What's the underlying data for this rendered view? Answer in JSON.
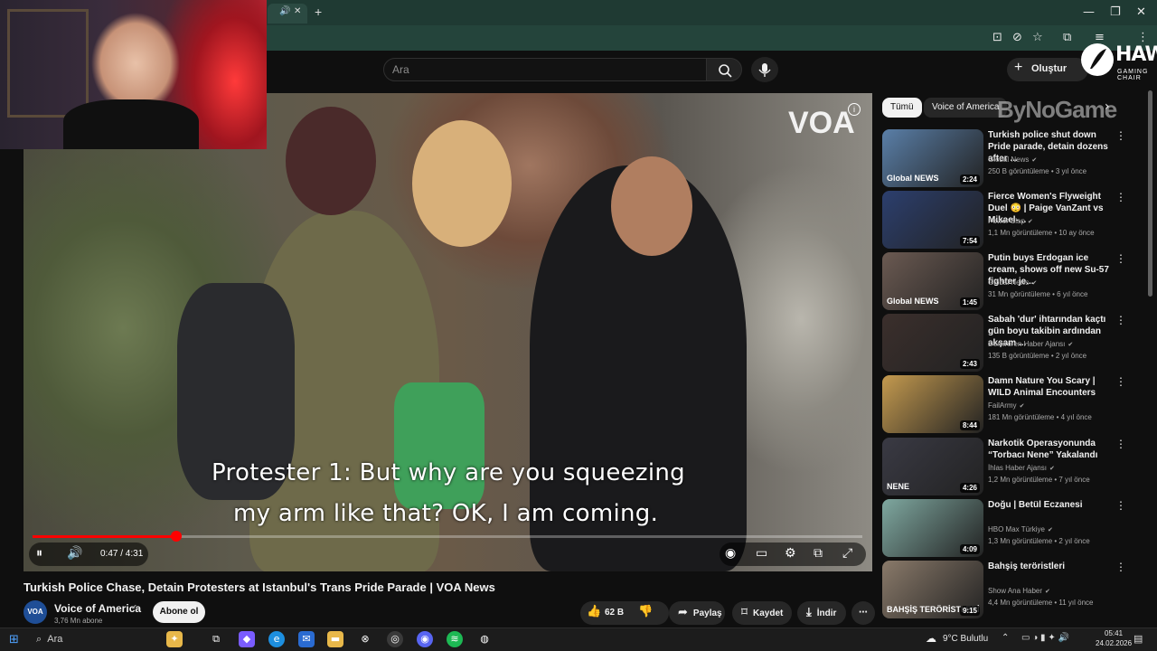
{
  "browser": {
    "tab_close": "✕",
    "new_tab": "+",
    "window_controls": [
      "—",
      "❐",
      "✕"
    ],
    "toolbar_icons": [
      "install-icon",
      "eye-off-icon",
      "star-icon",
      "extensions-icon",
      "profile-icon",
      "menu-icon"
    ]
  },
  "header": {
    "search_placeholder": "Ara",
    "create_label": "Oluştur"
  },
  "player": {
    "subtitle_line1": "Protester 1: But why are you squeezing",
    "subtitle_line2": "my arm like that? OK, I am coming.",
    "watermark": "VOA",
    "current_time": "0:47",
    "duration": "4:31",
    "time_display": "0:47 / 4:31",
    "progress_fraction": 0.173
  },
  "video": {
    "title": "Turkish Police Chase, Detain Protesters at Istanbul's Trans Pride Parade | VOA News",
    "channel_avatar": "VOA",
    "channel_name": "Voice of America",
    "subscribers": "3,76 Mn abone",
    "subscribe_label": "Abone ol",
    "like_count": "62 B",
    "share_label": "Paylaş",
    "save_label": "Kaydet",
    "download_label": "İndir"
  },
  "sidebar": {
    "chips": [
      "Tümü",
      "Voice of America"
    ],
    "recommendations": [
      {
        "title": "Turkish police shut down Pride parade, detain dozens after ...",
        "channel": "Global News",
        "meta": "250 B görüntüleme • 3 yıl önce",
        "duration": "2:24",
        "thumb_color": "#5a7fa8",
        "thumb_tag": "Global NEWS"
      },
      {
        "title": "Fierce Women's Flyweight Duel 😳 | Paige VanZant vs Mikael-...",
        "channel": "Power Slap",
        "meta": "1,1 Mn görüntüleme • 10 ay önce",
        "duration": "7:54",
        "thumb_color": "#2c3f6e",
        "thumb_tag": ""
      },
      {
        "title": "Putin buys Erdogan ice cream, shows off new Su-57 fighter je...",
        "channel": "Global News",
        "meta": "31 Mn görüntüleme • 6 yıl önce",
        "duration": "1:45",
        "thumb_color": "#6b5a52",
        "thumb_tag": "Global NEWS"
      },
      {
        "title": "Sabah 'dur' ihtarından kaçtı gün boyu takibin ardından akşam ...",
        "channel": "Demirören Haber Ajansı",
        "meta": "135 B görüntüleme • 2 yıl önce",
        "duration": "2:43",
        "thumb_color": "#3b2f2c",
        "thumb_tag": ""
      },
      {
        "title": "Damn Nature You Scary | WILD Animal Encounters",
        "channel": "FailArmy",
        "meta": "181 Mn görüntüleme • 4 yıl önce",
        "duration": "8:44",
        "thumb_color": "#c49a4f",
        "thumb_tag": ""
      },
      {
        "title": "Narkotik Operasyonunda “Torbacı Nene” Yakalandı",
        "channel": "İhlas Haber Ajansı",
        "meta": "1,2 Mn görüntüleme • 7 yıl önce",
        "duration": "4:26",
        "thumb_color": "#3a3a44",
        "thumb_tag": "NENE"
      },
      {
        "title": "Doğu | Betül Eczanesi",
        "channel": "HBO Max Türkiye",
        "meta": "1,3 Mn görüntüleme • 2 yıl önce",
        "duration": "4:09",
        "thumb_color": "#7fa8a0",
        "thumb_tag": ""
      },
      {
        "title": "Bahşiş teröristleri",
        "channel": "Show Ana Haber",
        "meta": "4,4 Mn görüntüleme • 11 yıl önce",
        "duration": "9:15",
        "thumb_color": "#8a7a6a",
        "thumb_tag": "BAHŞİŞ TERÖRİSTLERİ"
      }
    ]
  },
  "overlays": {
    "hawk_brand": "HAWK",
    "hawk_sub": "GAMING CHAIR",
    "bynogame": "ByNoGame"
  },
  "taskbar": {
    "search_label": "Ara",
    "weather": "9°C  Bulutlu",
    "time": "05:41",
    "date": "24.02.2026"
  }
}
